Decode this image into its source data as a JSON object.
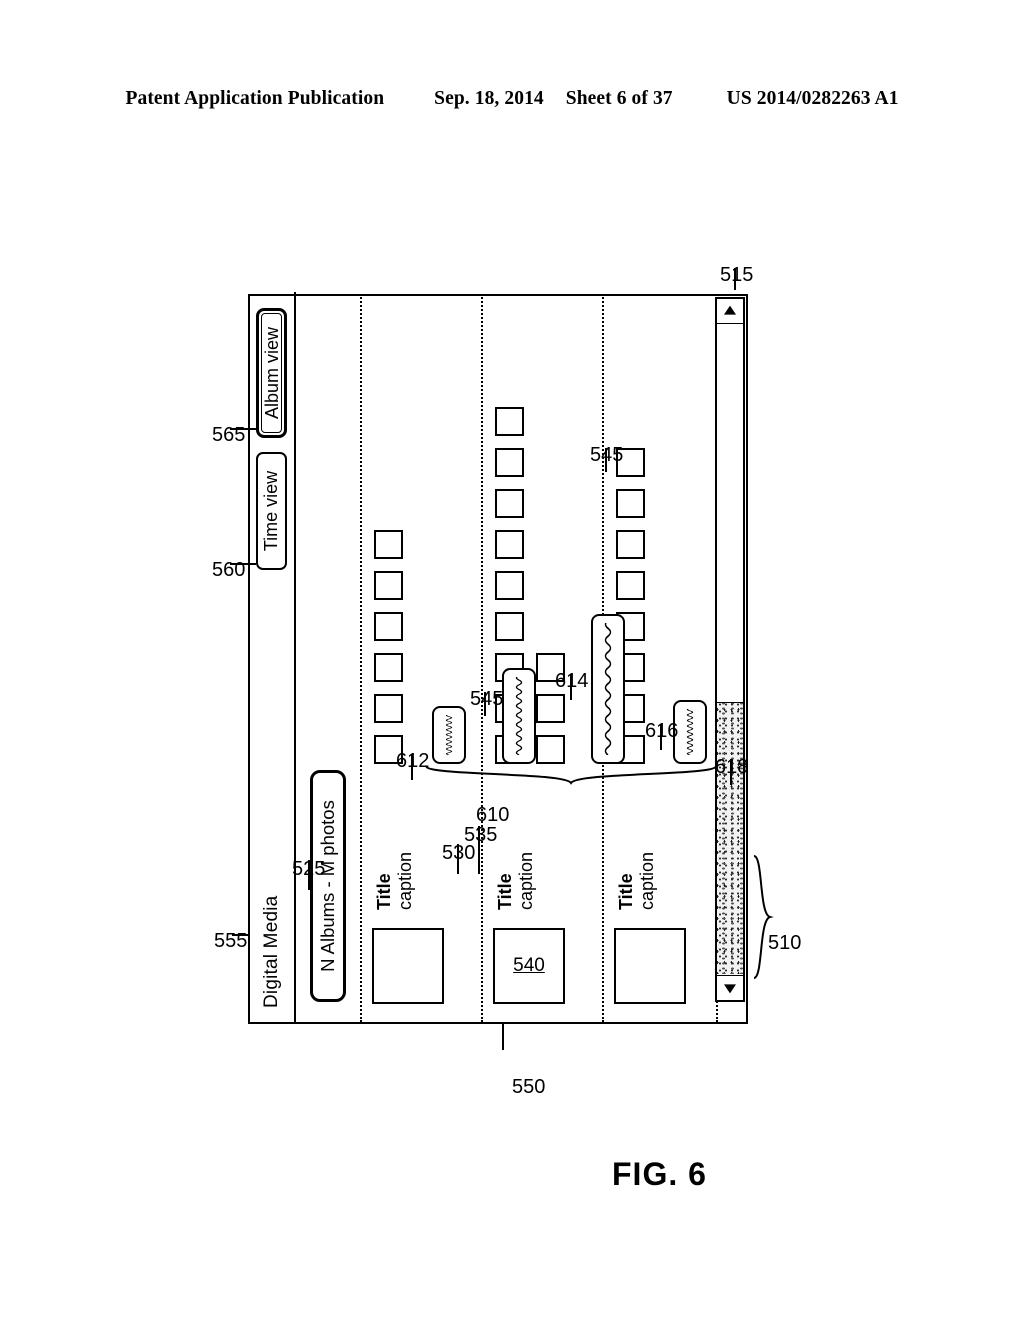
{
  "patent_header": {
    "publication": "Patent Application Publication",
    "date": "Sep. 18, 2014",
    "sheet": "Sheet 6 of 37",
    "number": "US 2014/0282263 A1"
  },
  "figure": {
    "caption": "FIG. 6"
  },
  "window": {
    "title": "Digital Media",
    "stats_pill": "N Albums - M photos",
    "toolbar": {
      "time_view_label": "Time view",
      "album_view_label": "Album view",
      "selected": "Album view"
    },
    "scrollbar": {
      "left_arrow_icon": "triangle-left-icon",
      "right_arrow_icon": "triangle-right-icon"
    }
  },
  "albums": [
    {
      "title": "Title",
      "caption": "caption",
      "cover_ref": "",
      "thumb_count": 6,
      "thumb_extra_count": 0
    },
    {
      "title": "Title",
      "caption": "caption",
      "cover_ref": "540",
      "thumb_count": 9,
      "thumb_extra_count": 3
    },
    {
      "title": "Title",
      "caption": "caption",
      "cover_ref": "",
      "thumb_count": 8,
      "thumb_extra_count": 0
    }
  ],
  "time_bars": [
    {
      "ref": "612",
      "length": 64
    },
    {
      "ref": "614",
      "length": 150
    },
    {
      "ref": "616",
      "length": 96
    },
    {
      "ref": "618",
      "length": 58
    }
  ],
  "reference_numerals": {
    "window_frame": "550",
    "album_section": "510",
    "scrollbar": "515",
    "stats_pill": "525",
    "album_title": "530",
    "album_caption": "535",
    "album_cover": "540",
    "photo_thumbnail": "545",
    "toolbar": "555",
    "time_view_button": "560",
    "album_view_button": "565",
    "time_bar_group": "610",
    "time_bar_1": "612",
    "time_bar_2": "614",
    "time_bar_3": "616",
    "time_bar_4": "618",
    "thumbnail_callout_a": "545",
    "thumbnail_callout_b": "545"
  },
  "colors": {
    "ink": "#000000",
    "paper": "#ffffff",
    "scroll_thumb": "#f2f2f2"
  }
}
